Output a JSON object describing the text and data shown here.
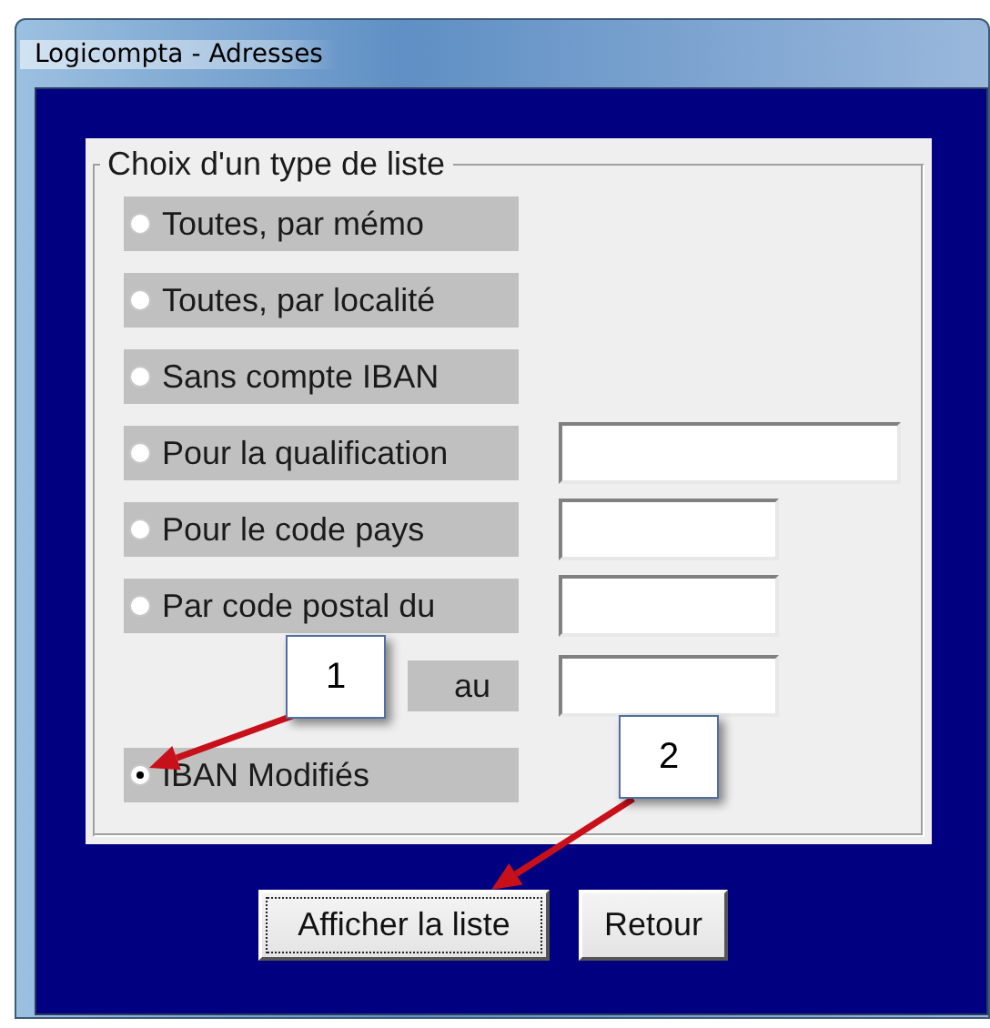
{
  "window": {
    "title": "Logicompta - Adresses"
  },
  "group": {
    "title": "Choix d'un type de liste"
  },
  "options": [
    {
      "kind": "plain",
      "label": "Toutes, par mémo",
      "selected": false
    },
    {
      "kind": "plain",
      "label": "Toutes, par localité",
      "selected": false
    },
    {
      "kind": "plain",
      "label": "Sans compte IBAN",
      "selected": false
    },
    {
      "kind": "wide-field",
      "label": "Pour la qualification",
      "selected": false
    },
    {
      "kind": "field",
      "label": "Pour le code pays",
      "selected": false
    },
    {
      "kind": "range",
      "label": "Par code postal du",
      "to_label": "au",
      "selected": false
    },
    {
      "kind": "plain",
      "label": "IBAN Modifiés",
      "selected": true
    }
  ],
  "buttons": [
    {
      "label": "Afficher la liste",
      "focused": true
    },
    {
      "label": "Retour",
      "focused": false
    }
  ],
  "callouts": [
    {
      "label": "1"
    },
    {
      "label": "2"
    }
  ]
}
